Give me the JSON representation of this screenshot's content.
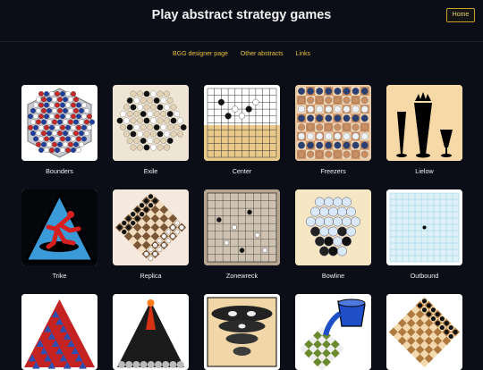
{
  "header": {
    "title": "Play abstract strategy games",
    "home_label": "Home"
  },
  "nav": {
    "links": [
      "BGG designer page",
      "Other abstracts",
      "Links"
    ]
  },
  "games": [
    {
      "name": "Bounders",
      "icon": "bounders-hex-board"
    },
    {
      "name": "Exile",
      "icon": "exile-hex-stones"
    },
    {
      "name": "Center",
      "icon": "center-go-board"
    },
    {
      "name": "Freezers",
      "icon": "freezers-checker-board"
    },
    {
      "name": "Lielow",
      "icon": "lielow-silhouettes"
    },
    {
      "name": "Trike",
      "icon": "trike-triangle-warning"
    },
    {
      "name": "Replica",
      "icon": "replica-diamond-board"
    },
    {
      "name": "Zonewreck",
      "icon": "zonewreck-grid-board"
    },
    {
      "name": "Bowline",
      "icon": "bowline-stacked-balls"
    },
    {
      "name": "Outbound",
      "icon": "outbound-square-grid"
    },
    {
      "name": "",
      "icon": "triangle-pyramid-board"
    },
    {
      "name": "",
      "icon": "volcano-pyramid"
    },
    {
      "name": "",
      "icon": "tornado-stones"
    },
    {
      "name": "",
      "icon": "paint-bucket-board"
    },
    {
      "name": "",
      "icon": "diamond-checker-board"
    }
  ]
}
